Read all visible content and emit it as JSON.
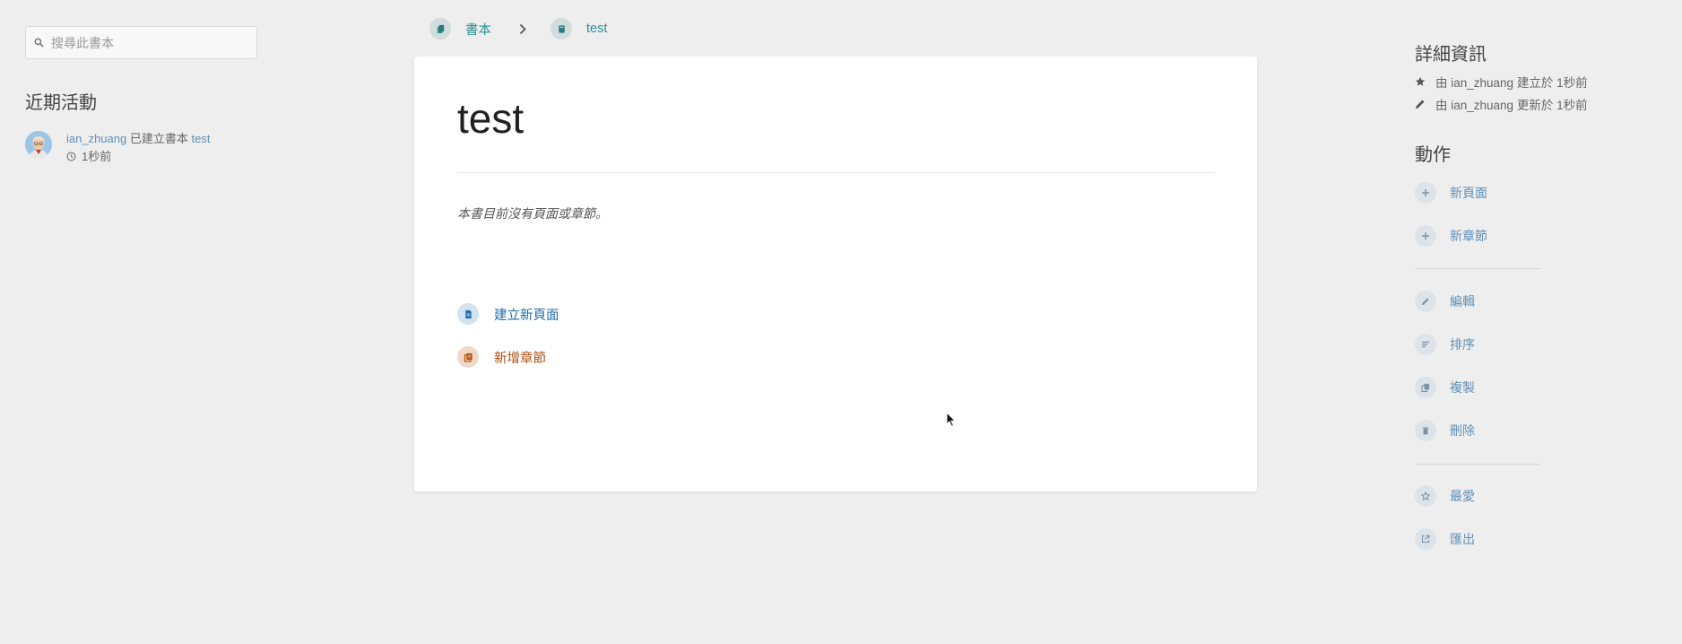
{
  "search": {
    "placeholder": "搜尋此書本",
    "icon": "search-icon"
  },
  "recent": {
    "heading": "近期活動",
    "items": [
      {
        "user": "ian_zhuang",
        "verb": "已建立書本",
        "book": "test",
        "time": "1秒前"
      }
    ]
  },
  "breadcrumb": {
    "items": [
      {
        "label": "書本",
        "icon": "books-icon"
      },
      {
        "label": "test",
        "icon": "book-icon"
      }
    ]
  },
  "book": {
    "title": "test",
    "empty_message": "本書目前沒有頁面或章節。",
    "create_page": "建立新頁面",
    "add_chapter": "新增章節"
  },
  "details": {
    "heading": "詳細資訊",
    "created": "由 ian_zhuang 建立於 1秒前",
    "updated": "由 ian_zhuang 更新於 1秒前"
  },
  "actions": {
    "heading": "動作",
    "new_page": "新頁面",
    "new_chapter": "新章節",
    "edit": "編輯",
    "sort": "排序",
    "copy": "複製",
    "delete": "刪除",
    "favourite": "最愛",
    "export": "匯出"
  },
  "colors": {
    "background": "#eeeeee",
    "link": "#5e8fb8",
    "breadcrumb": "#2f8f95",
    "page_action": "#206ea7",
    "chapter_action": "#af4d0d"
  }
}
